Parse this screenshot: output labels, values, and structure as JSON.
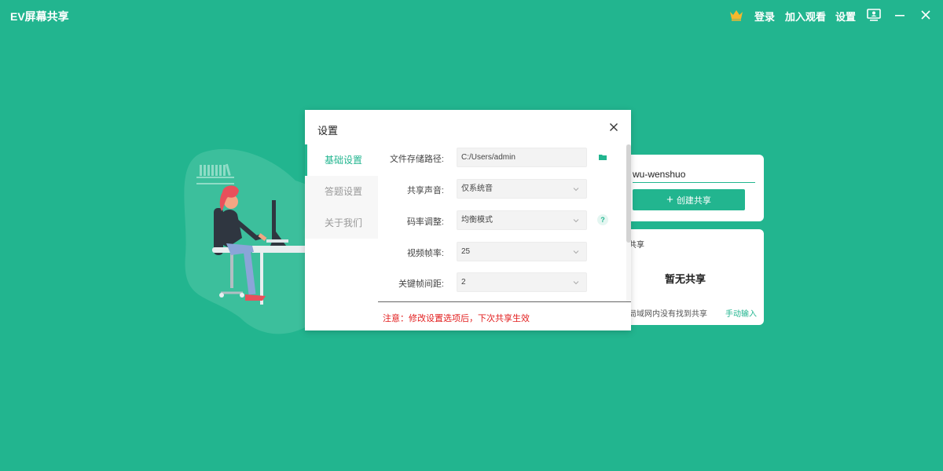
{
  "app": {
    "title": "EV屏幕共享"
  },
  "header": {
    "login": "登录",
    "join_watch": "加入观看",
    "settings": "设置"
  },
  "create_card": {
    "name_value": "wu-wenshuo",
    "create_button": "创建共享"
  },
  "share_list": {
    "title": "共享",
    "empty_text": "暂无共享",
    "hint": "局域网内没有找到共享",
    "manual_input": "手动输入"
  },
  "dialog": {
    "title": "设置",
    "tabs": [
      "基础设置",
      "答题设置",
      "关于我们"
    ],
    "active_tab": "基础设置",
    "fields": {
      "storage_path": {
        "label": "文件存储路径:",
        "value": "C:/Users/admin"
      },
      "share_audio": {
        "label": "共享声音:",
        "value": "仅系统音"
      },
      "bitrate": {
        "label": "码率调整:",
        "value": "均衡模式"
      },
      "frame_rate": {
        "label": "视频帧率:",
        "value": "25"
      },
      "keyframe_interval": {
        "label": "关键帧间距:",
        "value": "2"
      }
    },
    "notice": "注意：修改设置选项后，下次共享生效"
  },
  "colors": {
    "accent": "#22b58f",
    "warning": "#e21d1d"
  },
  "icons": [
    "crown-icon",
    "monitor-icon",
    "minimize-icon",
    "close-icon",
    "folder-icon",
    "help-icon",
    "chevron-down-icon",
    "plus-icon"
  ]
}
